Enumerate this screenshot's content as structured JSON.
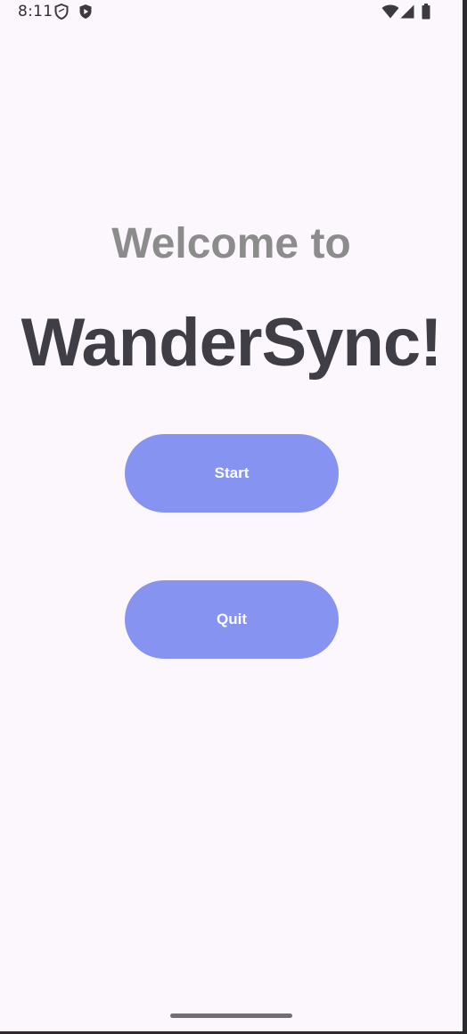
{
  "status_bar": {
    "time": "8:11",
    "left_icons": [
      "shield-outline-icon",
      "shield-play-icon"
    ],
    "right_icons": [
      "wifi-icon",
      "cellular-signal-icon",
      "battery-icon"
    ]
  },
  "main": {
    "welcome_text": "Welcome to",
    "app_name": "WanderSync!",
    "start_label": "Start",
    "quit_label": "Quit"
  },
  "colors": {
    "background": "#FCF7FC",
    "button": "#8793F0",
    "welcome_text": "#8C8C8C",
    "app_name_text": "#3F3D45"
  }
}
